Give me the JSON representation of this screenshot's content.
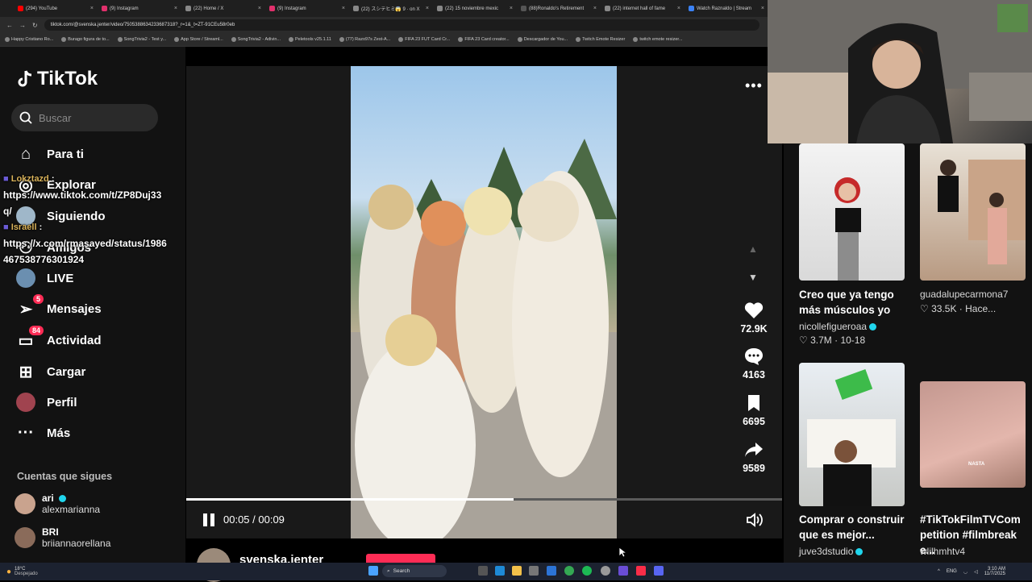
{
  "browser": {
    "tabs": [
      {
        "label": "(294) YouTube",
        "color": "#ff0000"
      },
      {
        "label": "(9) Instagram",
        "color": "#e1306c"
      },
      {
        "label": "(22) Home / X",
        "color": "#888888"
      },
      {
        "label": "(9) Instagram",
        "color": "#e1306c"
      },
      {
        "label": "(22) スシテヒミ😱 9 · on X",
        "color": "#888888"
      },
      {
        "label": "(22) 15 noviembre mexic",
        "color": "#888888"
      },
      {
        "label": "(88)Ronaldo's Retirement",
        "color": "#555555"
      },
      {
        "label": "(22) internet hall of fame",
        "color": "#888888"
      },
      {
        "label": "Watch Raznaldo | Stream",
        "color": "#3b82f6"
      }
    ],
    "url": "tiktok.com/@svenska.jenter/video/7505388634233687318?_r=1&_t=ZT-91CEu58r0eb",
    "bookmarks": [
      "Happy Cristiano Ro...",
      "Burago figura de to...",
      "SongTrivia2 - Test y...",
      "App Store / Streaml...",
      "SongTrivia2 - Adivin...",
      "Peletools v25.1.11",
      "(77) Razo97s Zest-A...",
      "FIFA 23 FUT Card Cr...",
      "FIFA 23 Card creator...",
      "Descargador de You...",
      "Twitch Emote Resizer",
      "twitch emote resizer..."
    ]
  },
  "sidebar": {
    "logo": "TikTok",
    "search_placeholder": "Buscar",
    "nav": [
      {
        "label": "Para ti",
        "icon": "home-icon"
      },
      {
        "label": "Explorar",
        "icon": "compass-icon"
      },
      {
        "label": "Siguiendo",
        "icon": "following-avatar-icon"
      },
      {
        "label": "Amigos",
        "icon": "friends-icon"
      },
      {
        "label": "LIVE",
        "icon": "live-icon"
      },
      {
        "label": "Mensajes",
        "icon": "send-icon",
        "badge": "5"
      },
      {
        "label": "Actividad",
        "icon": "inbox-icon",
        "badge": "84"
      },
      {
        "label": "Cargar",
        "icon": "plus-square-icon"
      },
      {
        "label": "Perfil",
        "icon": "profile-avatar-icon"
      },
      {
        "label": "Más",
        "icon": "more-icon"
      }
    ],
    "following_title": "Cuentas que sigues",
    "following": [
      {
        "name": "ari",
        "user": "alexmarianna",
        "verified": true
      },
      {
        "name": "BRI",
        "user": "briiannaorellana",
        "verified": false
      }
    ]
  },
  "chat": [
    {
      "user": "Lokztazd",
      "message": "https://www.tiktok.com/t/ZP8Duj33q/"
    },
    {
      "user": "Israell",
      "message": "https://x.com/rmasayed/status/1986467538776301924"
    }
  ],
  "player": {
    "progress": 0.55,
    "time": "00:05 / 00:09",
    "likes": "72.9K",
    "comments": "4163",
    "saves": "6695",
    "shares": "9589",
    "author": "svenska.jenter"
  },
  "recommended": [
    {
      "title": "Creo que ya tengo más músculos yo",
      "author": "nicollefigueroaa",
      "verified": true,
      "meta": "3.7M · 10-18"
    },
    {
      "title": "",
      "author": "guadalupecarmona7",
      "verified": false,
      "meta": "33.5K · Hace..."
    },
    {
      "title": "Comprar o construir que es mejor...",
      "author": "juve3dstudio",
      "verified": true,
      "meta": ""
    },
    {
      "title": "#TikTokFilmTVCompetition #filmbreake...",
      "author": "wlilhmhtv4",
      "verified": false,
      "meta": ""
    }
  ],
  "thumb_text": "NASTA",
  "taskbar": {
    "weather_temp": "18°C",
    "weather_desc": "Despejado",
    "search": "Search",
    "lang": "ENG",
    "time": "3:10 AM",
    "date": "11/7/2025"
  }
}
